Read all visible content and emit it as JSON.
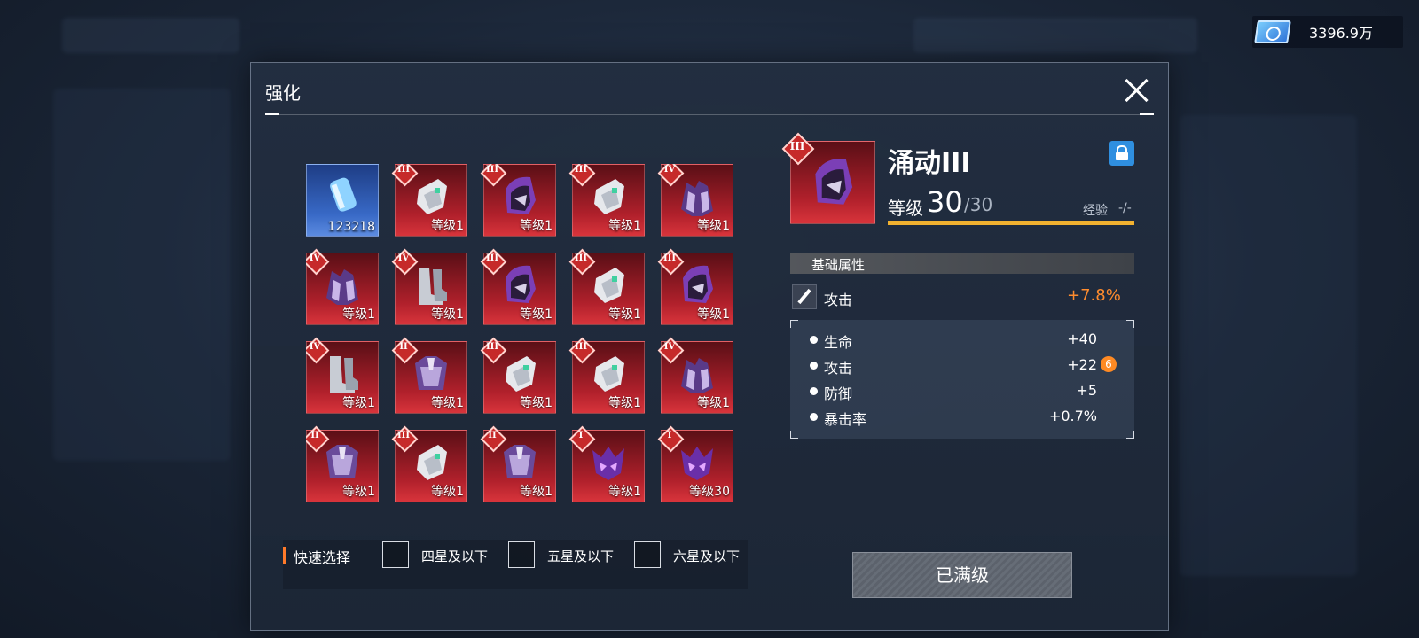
{
  "currency": {
    "amount": "3396.9万",
    "icon": "ticket-icon"
  },
  "dialog": {
    "title": "强化",
    "items": [
      {
        "type": "material",
        "qty": "123218"
      },
      {
        "rank": "III",
        "level": "等级1",
        "kind": "glove"
      },
      {
        "rank": "III",
        "level": "等级1",
        "kind": "helm"
      },
      {
        "rank": "III",
        "level": "等级1",
        "kind": "glove"
      },
      {
        "rank": "IV",
        "level": "等级1",
        "kind": "armor"
      },
      {
        "rank": "IV",
        "level": "等级1",
        "kind": "armor"
      },
      {
        "rank": "IV",
        "level": "等级1",
        "kind": "boots"
      },
      {
        "rank": "III",
        "level": "等级1",
        "kind": "helm"
      },
      {
        "rank": "III",
        "level": "等级1",
        "kind": "glove"
      },
      {
        "rank": "III",
        "level": "等级1",
        "kind": "helm"
      },
      {
        "rank": "IV",
        "level": "等级1",
        "kind": "boots"
      },
      {
        "rank": "II",
        "level": "等级1",
        "kind": "chest"
      },
      {
        "rank": "III",
        "level": "等级1",
        "kind": "glove"
      },
      {
        "rank": "III",
        "level": "等级1",
        "kind": "glove"
      },
      {
        "rank": "IV",
        "level": "等级1",
        "kind": "armor"
      },
      {
        "rank": "II",
        "level": "等级1",
        "kind": "chest"
      },
      {
        "rank": "III",
        "level": "等级1",
        "kind": "glove"
      },
      {
        "rank": "II",
        "level": "等级1",
        "kind": "chest"
      },
      {
        "rank": "I",
        "level": "等级1",
        "kind": "mask"
      },
      {
        "rank": "I",
        "level": "等级30",
        "kind": "mask"
      }
    ],
    "quick_select": {
      "label": "快速选择",
      "options": [
        "四星及以下",
        "五星及以下",
        "六星及以下"
      ]
    },
    "detail": {
      "rank": "III",
      "name": "涌动III",
      "level_label": "等级",
      "level_current": "30",
      "level_max": "/30",
      "exp_label": "经验",
      "exp_value": "-/-",
      "section_title": "基础属性",
      "main_attr": {
        "name": "攻击",
        "value": "+7.8%"
      },
      "sub_attrs": [
        {
          "name": "生命",
          "value": "+40"
        },
        {
          "name": "攻击",
          "value": "+22",
          "badge": "6"
        },
        {
          "name": "防御",
          "value": "+5"
        },
        {
          "name": "暴击率",
          "value": "+0.7%"
        }
      ],
      "button": "已满级"
    }
  }
}
